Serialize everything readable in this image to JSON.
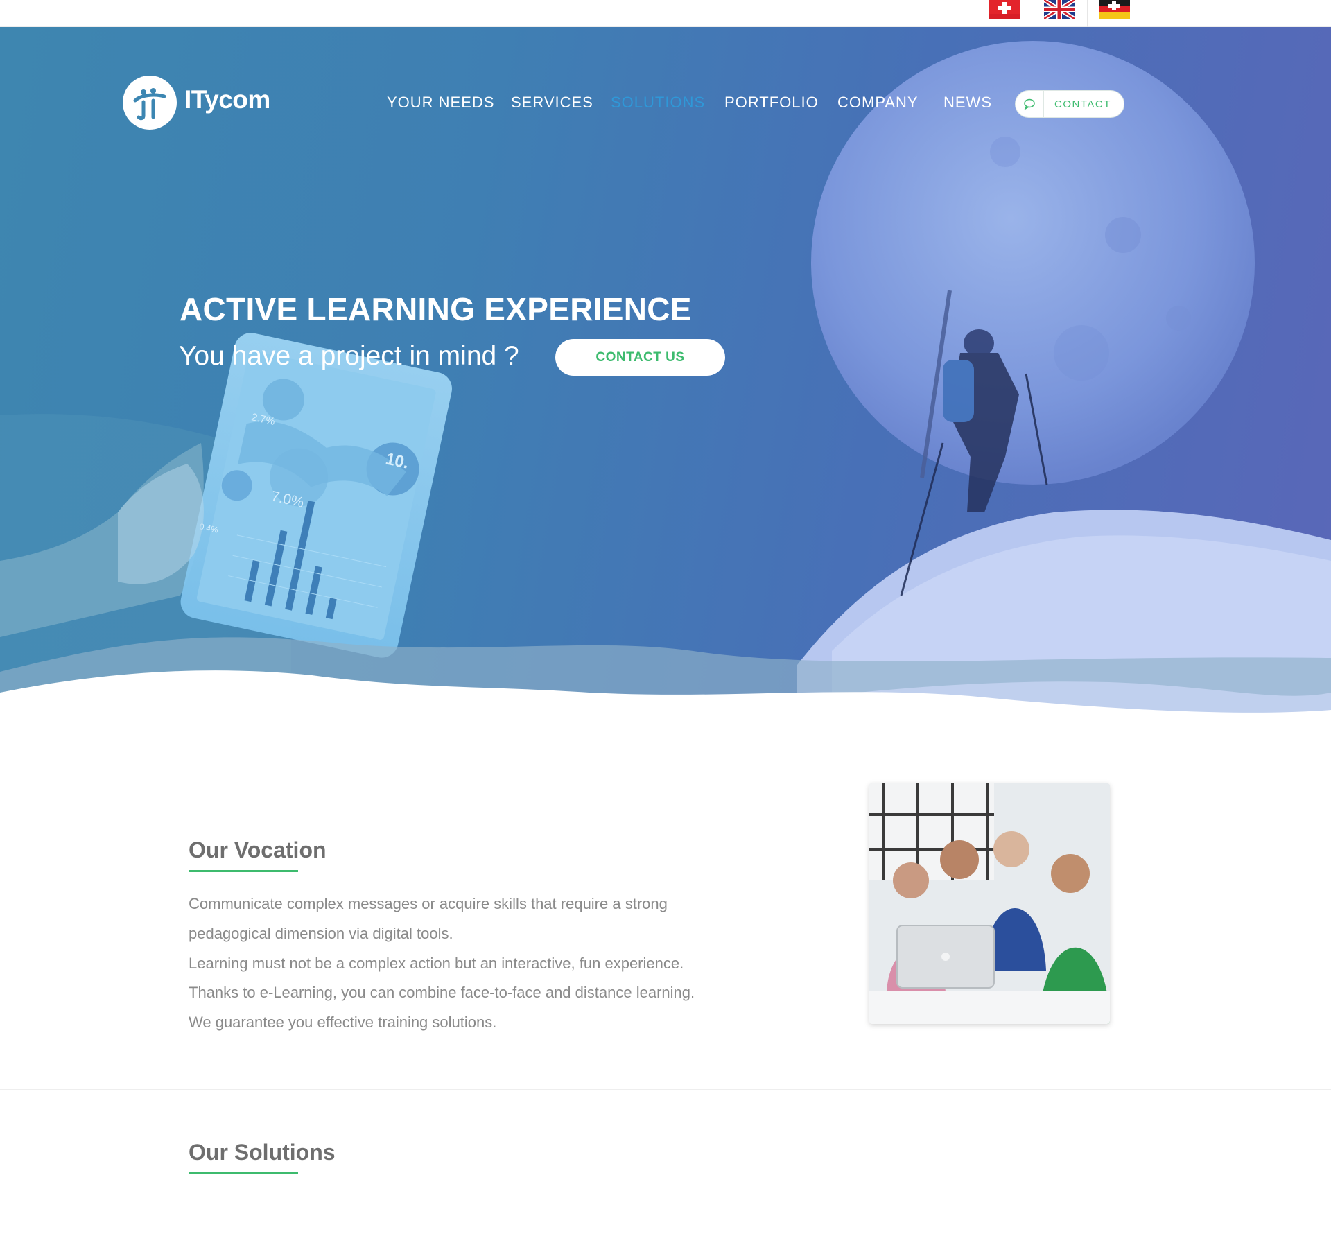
{
  "languages": [
    {
      "name": "swiss-flag-icon",
      "label": ""
    },
    {
      "name": "uk-flag-icon",
      "label": ""
    },
    {
      "name": "german-flag-icon",
      "label": ""
    }
  ],
  "brand": {
    "name": "ITycom"
  },
  "nav": {
    "items": [
      "YOUR NEEDS",
      "SERVICES",
      "SOLUTIONS",
      "PORTFOLIO",
      "COMPANY",
      "NEWS"
    ],
    "active": "SOLUTIONS",
    "contact_label": "CONTACT"
  },
  "hero": {
    "title": "ACTIVE LEARNING EXPERIENCE",
    "subtitle": "You have a project in mind ?",
    "cta_label": "CONTACT US",
    "tablet_labels": [
      "2.7%",
      "10.",
      "7.0%",
      "0.4%"
    ]
  },
  "vocation": {
    "title": "Our Vocation",
    "paragraphs": [
      "Communicate complex messages or acquire skills that require a strong",
      "pedagogical dimension via digital tools.",
      "Learning must not be a complex action but an interactive, fun experience.",
      "Thanks to e-Learning, you can combine face-to-face and distance learning.",
      "We guarantee you effective training solutions."
    ]
  },
  "solutions": {
    "title": "Our Solutions"
  },
  "colors": {
    "accent_green": "#3dbb6e",
    "active_blue": "#2f98d8",
    "hero_start": "#3e86b0",
    "hero_end": "#5a67b8"
  }
}
